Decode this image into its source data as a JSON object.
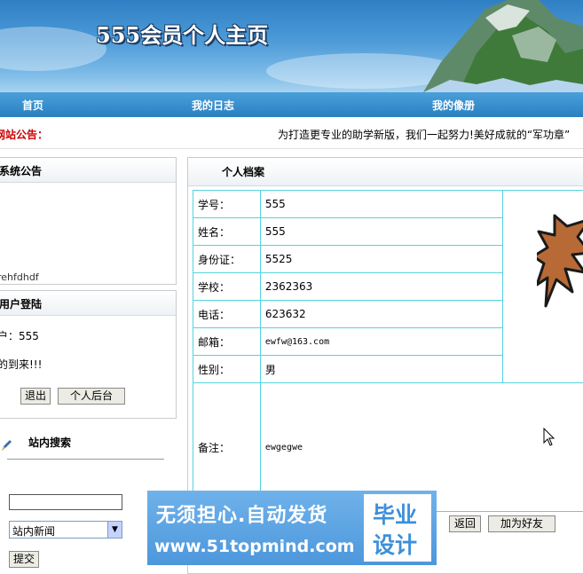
{
  "banner": {
    "title": "555会员个人主页"
  },
  "nav": [
    {
      "label": "首页"
    },
    {
      "label": "我的日志"
    },
    {
      "label": "我的像册"
    }
  ],
  "notice": {
    "label": "网站公告：",
    "text": "为打造更专业的助学新版，我们一起努力!美好成就的“军功章”"
  },
  "sidebar": {
    "system_notice": {
      "title": "系统公告",
      "scroll_text": "rehfdhdf"
    },
    "login": {
      "title": "用户登陆",
      "user_line": "户：555",
      "welcome": "的到来!!!",
      "logout_label": "退出",
      "backend_label": "个人后台"
    },
    "search": {
      "title": "站内搜索",
      "input_value": "",
      "selected_option": "站内新闻",
      "submit_label": "提交"
    }
  },
  "profile": {
    "title": "个人档案",
    "fields": [
      {
        "label": "学号：",
        "value": "555"
      },
      {
        "label": "姓名：",
        "value": "555"
      },
      {
        "label": "身份证：",
        "value": "5525"
      },
      {
        "label": "学校：",
        "value": "2362363"
      },
      {
        "label": "电话：",
        "value": "623632"
      },
      {
        "label": "邮箱：",
        "value": "ewfw@163.com"
      },
      {
        "label": "性别：",
        "value": "男"
      }
    ],
    "remark": {
      "label": "备注：",
      "value": "ewgegwe"
    },
    "back_label": "返回",
    "add_friend_label": "加为好友"
  },
  "watermark": {
    "line1": "无须担心.自动发货",
    "line2": "www.51topmind.com",
    "logo_top": "毕业",
    "logo_bottom": "设计"
  },
  "colors": {
    "table_border": "#55d3e0",
    "notice_label": "#cc0000",
    "nav": "#2a7fc0"
  }
}
